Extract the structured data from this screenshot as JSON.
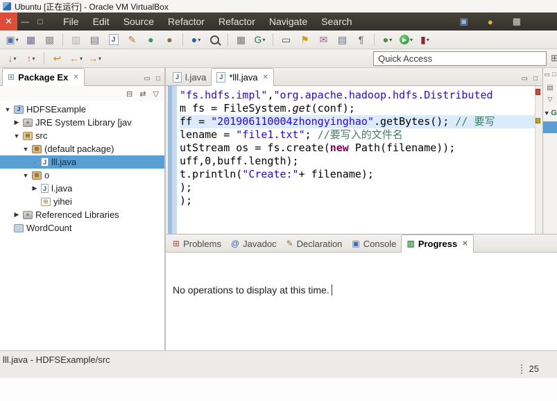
{
  "window": {
    "title": "Ubuntu [正在运行] - Oracle VM VirtualBox"
  },
  "menubar": {
    "items": [
      "File",
      "Edit",
      "Source",
      "Refactor",
      "Refactor",
      "Navigate",
      "Search"
    ]
  },
  "indicator_icons": [
    {
      "name": "display-indicator",
      "glyph": "▣",
      "color": "#8fb6e8"
    },
    {
      "name": "input-method-indicator",
      "glyph": "●",
      "color": "#d9b83c"
    },
    {
      "name": "keyboard-indicator",
      "glyph": "▦",
      "color": "#dedad2"
    }
  ],
  "icons": {
    "close": "✕",
    "window_min": "—",
    "window_max": "□",
    "panel_min": "▭",
    "panel_max": "□",
    "view_menu": "▽",
    "collapse_all": "⊟",
    "link_editor": "⇄",
    "tab_close": "✕",
    "expander_open": "▼",
    "perspective": "⊞",
    "package_explorer": "⊞",
    "view_misc": "▤"
  },
  "toolbar_main": [
    {
      "name": "new-wizard",
      "glyph": "▣",
      "color": "#4a76b8",
      "caret": true
    },
    {
      "name": "save",
      "glyph": "▦",
      "color": "#6f5fae"
    },
    {
      "name": "save-all",
      "glyph": "▩",
      "color": "#8f8f8f"
    },
    {
      "sep": true
    },
    {
      "name": "coverage-last",
      "glyph": "▥",
      "color": "#b4b0ab"
    },
    {
      "name": "new-report",
      "glyph": "▤",
      "color": "#3f74b8"
    },
    {
      "name": "new-java-class",
      "glyph": "J",
      "color": "#2359b0",
      "boxed": true
    },
    {
      "name": "annotate",
      "glyph": "✎",
      "color": "#b08030"
    },
    {
      "name": "synchronize",
      "glyph": "●",
      "color": "#3f8f5f"
    },
    {
      "name": "team-share",
      "glyph": "●",
      "color": "#8a6d3b"
    },
    {
      "sep": true
    },
    {
      "name": "debug-user",
      "glyph": "●",
      "color": "#2a5db8",
      "caret": true
    },
    {
      "name": "search",
      "css": "magnifier"
    },
    {
      "sep": true
    },
    {
      "name": "open-type",
      "glyph": "▦",
      "color": "#777777"
    },
    {
      "name": "web-browser",
      "glyph": "G",
      "color": "#1f7a3f",
      "caret": true
    },
    {
      "sep": true
    },
    {
      "name": "terminal",
      "glyph": "▭",
      "color": "#555555"
    },
    {
      "name": "flashlight",
      "glyph": "⚑",
      "color": "#d0a010"
    },
    {
      "name": "mail",
      "glyph": "✉",
      "color": "#9a5a8a"
    },
    {
      "name": "new-document",
      "glyph": "▤",
      "color": "#3f74b8"
    },
    {
      "name": "show-whitespace",
      "glyph": "¶",
      "color": "#666666"
    },
    {
      "sep": true
    },
    {
      "name": "debug",
      "glyph": "●",
      "color": "#3f8f3f",
      "caret": true
    },
    {
      "name": "run",
      "glyph": "▶",
      "css": "run-circle",
      "caret": true
    },
    {
      "name": "coverage",
      "glyph": "▮",
      "color": "#8a2b2b",
      "caret": true
    }
  ],
  "toolbar_nav": [
    {
      "name": "next-annotation",
      "glyph": "↓",
      "color": "#b08030",
      "caret": true
    },
    {
      "name": "previous-annotation",
      "glyph": "↑",
      "color": "#b08030",
      "caret": true
    },
    {
      "sep": true
    },
    {
      "name": "last-edit-location",
      "glyph": "↩",
      "color": "#b8922f"
    },
    {
      "name": "back",
      "glyph": "←",
      "color": "#b8922f",
      "caret": true
    },
    {
      "name": "forward",
      "glyph": "→",
      "color": "#b8922f",
      "caret": true
    }
  ],
  "quick_access": {
    "label": "Quick Access"
  },
  "package_explorer": {
    "title": "Package Ex",
    "tree": [
      {
        "label": "HDFSExample",
        "level": 0,
        "expand": "open",
        "icon": "project"
      },
      {
        "label": "JRE System Library [jav",
        "level": 1,
        "expand": "closed",
        "icon": "library"
      },
      {
        "label": "src",
        "level": 1,
        "expand": "open",
        "icon": "src"
      },
      {
        "label": "(default package)",
        "level": 2,
        "expand": "open",
        "icon": "package"
      },
      {
        "label": "lll.java",
        "level": 3,
        "expand": "dot",
        "icon": "java",
        "selected": true
      },
      {
        "label": "o",
        "level": 2,
        "expand": "open",
        "icon": "package"
      },
      {
        "label": "l.java",
        "level": 3,
        "expand": "closed",
        "icon": "java"
      },
      {
        "label": "yihei",
        "level": 3,
        "expand": "none",
        "icon": "package_empty"
      },
      {
        "label": "Referenced Libraries",
        "level": 1,
        "expand": "closed",
        "icon": "library"
      },
      {
        "label": "WordCount",
        "level": 0,
        "expand": "none",
        "icon": "folder"
      }
    ]
  },
  "editor": {
    "tabs": [
      {
        "label": "l.java",
        "active": false,
        "closable": false
      },
      {
        "label": "*lll.java",
        "active": true,
        "closable": true
      }
    ],
    "lines": [
      {
        "hl": false,
        "segs": [
          {
            "c": "str",
            "t": "\"fs.hdfs.impl\""
          },
          {
            "c": "def",
            "t": ","
          },
          {
            "c": "str",
            "t": "\"org.apache.hadoop.hdfs.Distributed"
          }
        ]
      },
      {
        "hl": false,
        "segs": [
          {
            "c": "def",
            "t": "m fs = FileSystem."
          },
          {
            "c": "static",
            "t": "get"
          },
          {
            "c": "def",
            "t": "(conf);"
          }
        ]
      },
      {
        "hl": true,
        "segs": [
          {
            "c": "def",
            "t": "ff = "
          },
          {
            "c": "str",
            "t": "\"201906110004zhongyinghao\""
          },
          {
            "c": "def",
            "t": ".getBytes(); "
          },
          {
            "c": "com",
            "t": "// 要写"
          }
        ]
      },
      {
        "hl": false,
        "segs": [
          {
            "c": "def",
            "t": "lename = "
          },
          {
            "c": "str",
            "t": "\"file1.txt\""
          },
          {
            "c": "def",
            "t": "; "
          },
          {
            "c": "com",
            "t": "//要写入的文件名"
          }
        ]
      },
      {
        "hl": false,
        "segs": [
          {
            "c": "def",
            "t": "utStream os = fs.create("
          },
          {
            "c": "kw",
            "t": "new"
          },
          {
            "c": "def",
            "t": " Path(filename));"
          }
        ]
      },
      {
        "hl": false,
        "segs": [
          {
            "c": "def",
            "t": "uff,0,buff.length);"
          }
        ]
      },
      {
        "hl": false,
        "segs": [
          {
            "c": "def",
            "t": "t.println("
          },
          {
            "c": "str",
            "t": "\"Create:\""
          },
          {
            "c": "def",
            "t": "+ filename);"
          }
        ]
      },
      {
        "hl": false,
        "segs": [
          {
            "c": "def",
            "t": ");"
          }
        ]
      },
      {
        "hl": false,
        "segs": [
          {
            "c": "def",
            "t": ");"
          }
        ]
      }
    ]
  },
  "outline_sliver": {
    "fragment": "G"
  },
  "bottom_panel": {
    "tabs": [
      {
        "label": "Problems",
        "glyph": "⊞",
        "color": "#b04a3a",
        "active": false,
        "closable": false
      },
      {
        "label": "Javadoc",
        "glyph": "@",
        "color": "#2a5db0",
        "active": false,
        "closable": false
      },
      {
        "label": "Declaration",
        "glyph": "✎",
        "color": "#8a7a3a",
        "active": false,
        "closable": false
      },
      {
        "label": "Console",
        "glyph": "▣",
        "color": "#3a6db5",
        "active": false,
        "closable": false
      },
      {
        "label": "Progress",
        "glyph": "▥",
        "color": "#4a8f4a",
        "active": true,
        "closable": true
      }
    ],
    "message": "No operations to display at this time."
  },
  "statusbar": {
    "left": "lll.java - HDFSExample/src",
    "right": "25"
  }
}
